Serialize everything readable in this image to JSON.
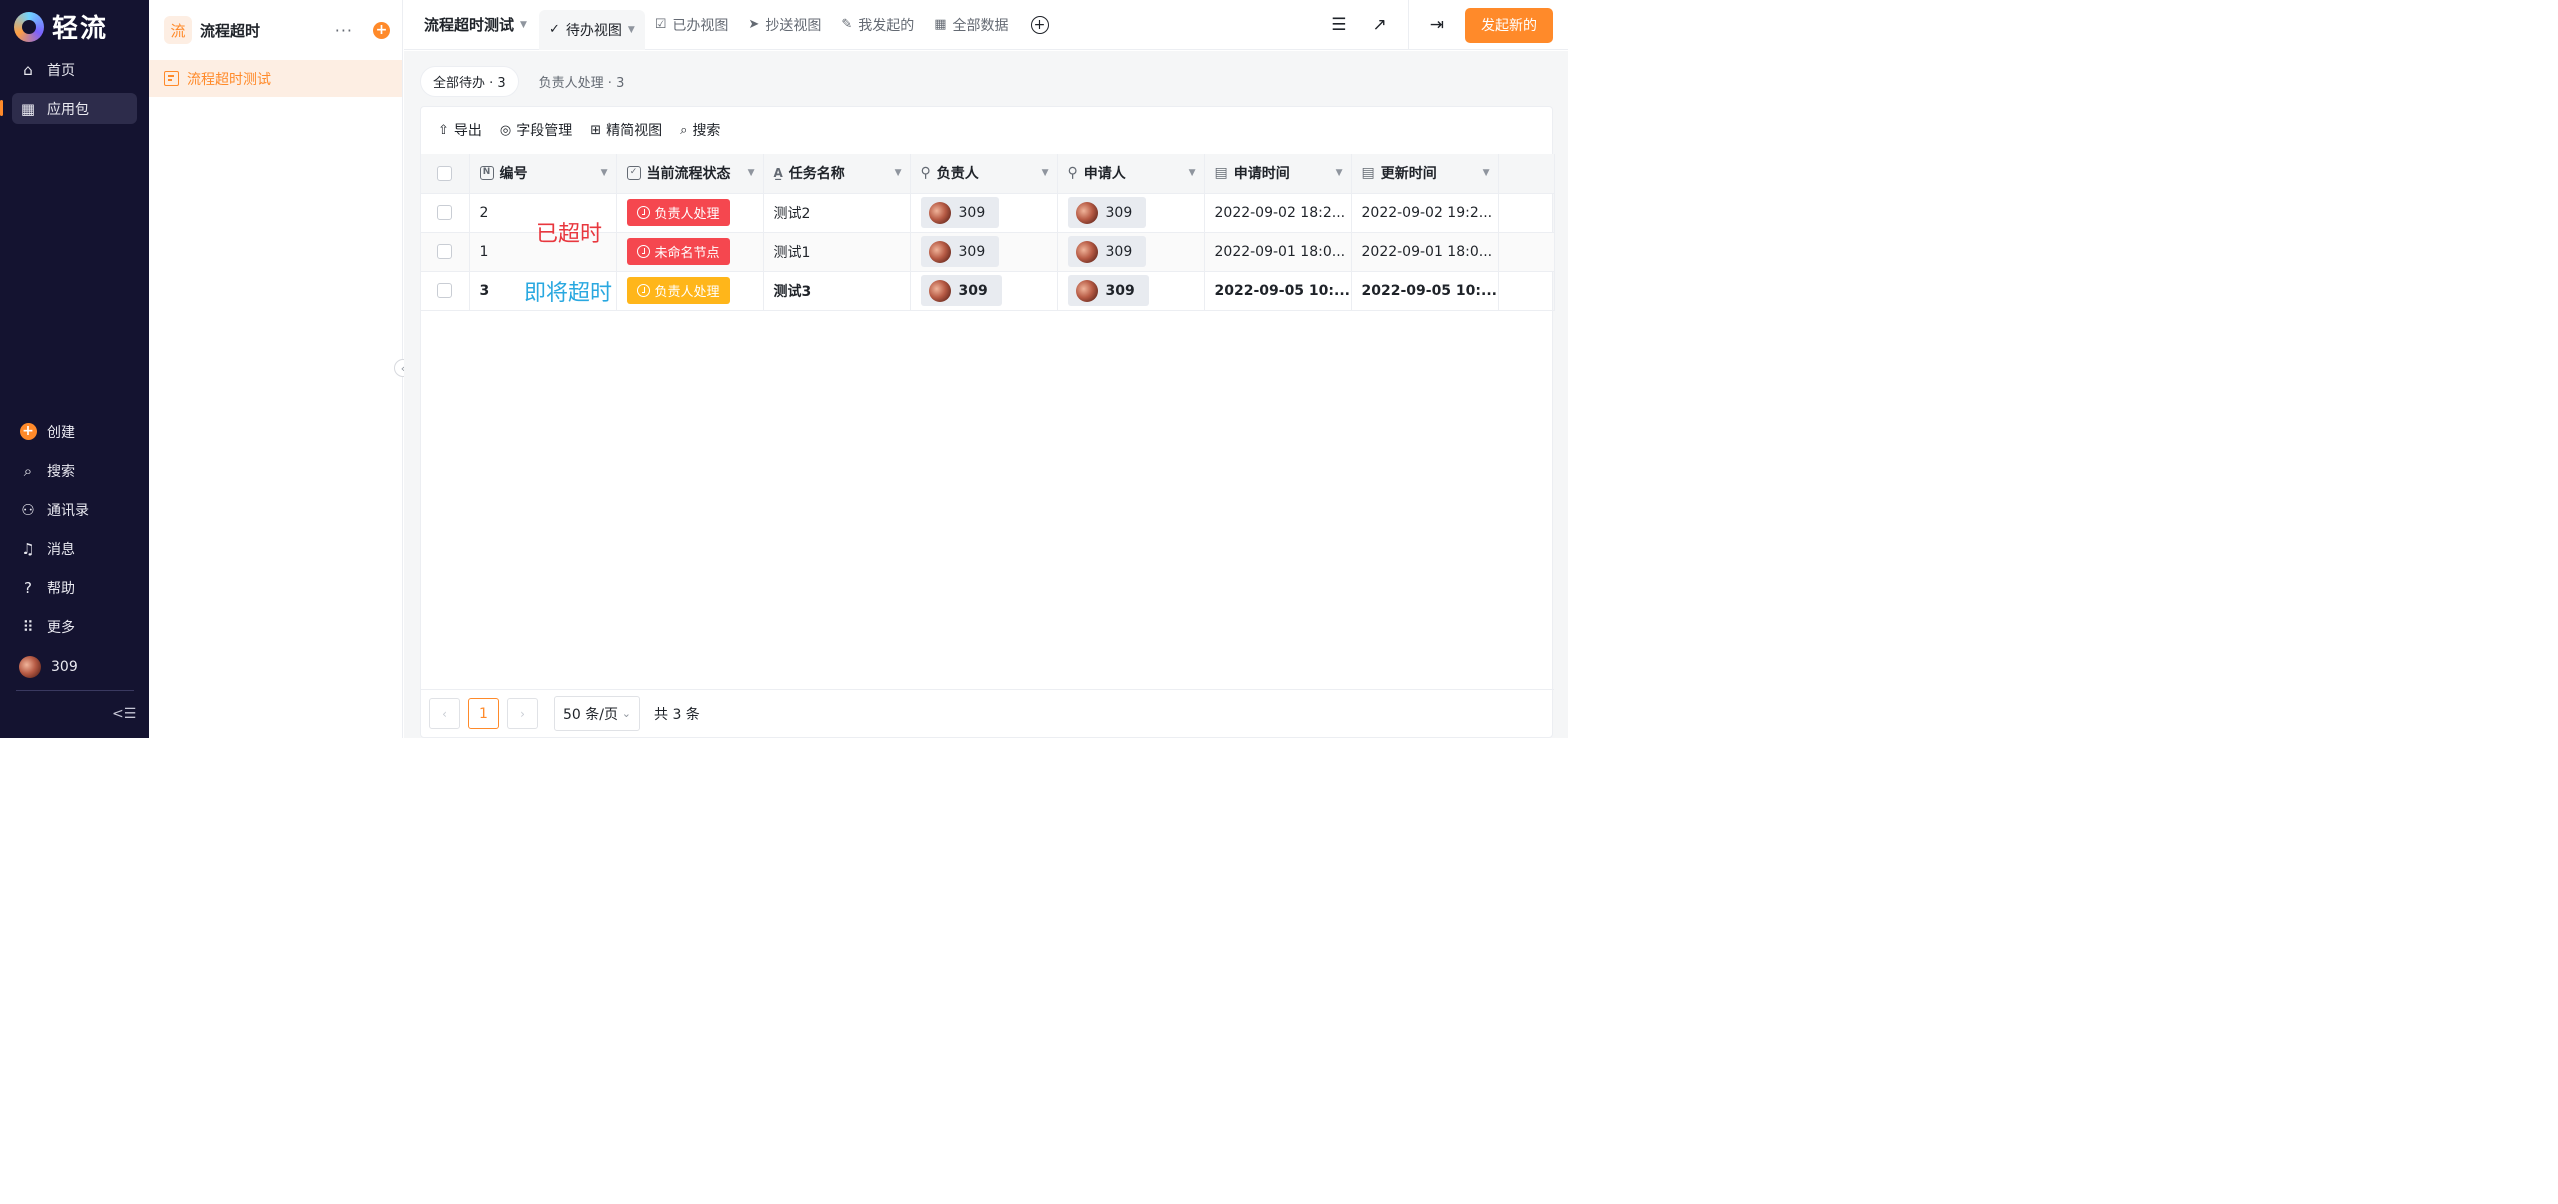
{
  "nav": {
    "brand": "轻流",
    "items": [
      {
        "label": "首页"
      },
      {
        "label": "应用包"
      }
    ],
    "bottom": [
      {
        "label": "创建"
      },
      {
        "label": "搜索"
      },
      {
        "label": "通讯录"
      },
      {
        "label": "消息"
      },
      {
        "label": "帮助"
      },
      {
        "label": "更多"
      },
      {
        "label": "309"
      }
    ]
  },
  "sidebar": {
    "badge": "流",
    "title": "流程超时",
    "more": "···",
    "add": "+",
    "items": [
      {
        "label": "流程超时测试"
      }
    ]
  },
  "topbar": {
    "app_title": "流程超时测试",
    "tabs": [
      {
        "label": "待办视图"
      },
      {
        "label": "已办视图"
      },
      {
        "label": "抄送视图"
      },
      {
        "label": "我发起的"
      },
      {
        "label": "全部数据"
      }
    ],
    "launch_label": "发起新的"
  },
  "filters": [
    {
      "label": "全部待办 · 3"
    },
    {
      "label": "负责人处理 · 3"
    }
  ],
  "toolbar": {
    "export": "导出",
    "fields": "字段管理",
    "compact": "精简视图",
    "search": "搜索"
  },
  "table": {
    "columns": [
      {
        "label": "编号"
      },
      {
        "label": "当前流程状态"
      },
      {
        "label": "任务名称"
      },
      {
        "label": "负责人"
      },
      {
        "label": "申请人"
      },
      {
        "label": "申请时间"
      },
      {
        "label": "更新时间"
      }
    ],
    "rows": [
      {
        "id": "2",
        "status": "负责人处理",
        "status_color": "#f5474f",
        "task": "测试2",
        "owner": "309",
        "applicant": "309",
        "apply_time": "2022-09-02 18:2...",
        "update_time": "2022-09-02 19:2..."
      },
      {
        "id": "1",
        "status": "未命名节点",
        "status_color": "#f5474f",
        "task": "测试1",
        "owner": "309",
        "applicant": "309",
        "apply_time": "2022-09-01 18:0...",
        "update_time": "2022-09-01 18:0..."
      },
      {
        "id": "3",
        "status": "负责人处理",
        "status_color": "#ffb61a",
        "task": "测试3",
        "owner": "309",
        "applicant": "309",
        "apply_time": "2022-09-05 10:...",
        "update_time": "2022-09-05 10:..."
      }
    ]
  },
  "annotations": {
    "overdue": "已超时",
    "near_overdue": "即将超时"
  },
  "pager": {
    "current": "1",
    "page_size": "50 条/页",
    "total": "共 3 条"
  },
  "colors": {
    "accent": "#ff8a2a",
    "nav_bg": "#141330",
    "overdue_red": "#f5474f",
    "warning_yellow": "#ffb61a"
  }
}
